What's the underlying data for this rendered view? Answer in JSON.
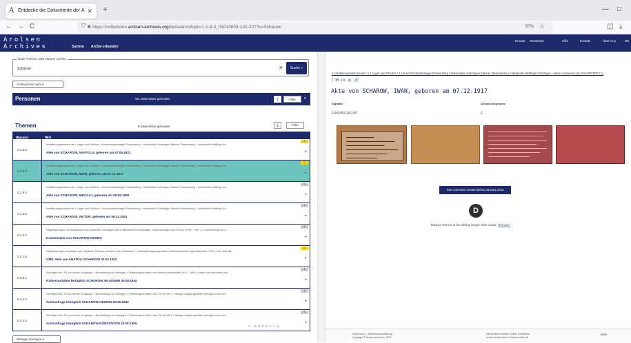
{
  "browser": {
    "tab_title": "Entdecke die Dokumente der A",
    "tab_close": "✕",
    "new_tab": "+",
    "url_prefix": "https://collections.",
    "url_domain": "arolsen-archives.org",
    "url_suffix": "/de/search/topic/1-1-8-3_01010803-102-207?s=Scharow",
    "zoom": "67%",
    "back_icon": "←",
    "forward_icon": "→",
    "reload_icon": "C",
    "minimize": "—",
    "maximize": "□",
    "pocket_icon": "◫",
    "download_icon": "⤓"
  },
  "site": {
    "logo_line1": "Arolsen",
    "logo_line2": "Archives",
    "nav": [
      "Suchen",
      "Archiv erkunden"
    ],
    "top_nav": [
      "Donate",
      "Newsletter",
      "Hilfe",
      "Kontakt",
      "Über Uns",
      "DE"
    ],
    "brand_color": "#1c2a6b"
  },
  "search": {
    "label": "Nach Themen oder Namen suchen",
    "value": "Scharow",
    "clear_icon": "×",
    "button": "Suche",
    "tree_button": "Archival tree units"
  },
  "personen": {
    "title": "Personen",
    "count": "781 Datensätze gefunden",
    "filter": "Filter"
  },
  "themen": {
    "title": "Themen",
    "count": "9 Datensätze gefunden",
    "filter": "Filter",
    "col_signatur": "Signatur",
    "col_titel": "Titel",
    "rows": [
      {
        "sig": "1.1.8.3",
        "bc": "Inhaftierungsdokumente > Lager und Ghettos > Konzentrationslager Flossenbürg > Individuelle Unterlagen Männer Flossenbürg > Individuelle Häftlings Un...",
        "title": "Akte von SCHAROW, ANATOLIJ, geboren am 27.09.1921",
        "count": "1"
      },
      {
        "sig": "1.1.8.3",
        "bc": "Inhaftierungsdokumente > Lager und Ghettos > Konzentrationslager Flossenbürg > Individuelle Unterlagen Männer Flossenbürg > Individuelle Häftlings Un...",
        "title": "Akte von SCHAROW, IWAN, geboren am 07.12.1917",
        "count": "2"
      },
      {
        "sig": "1.1.8.3",
        "bc": "Inhaftierungsdokumente > Lager und Ghettos > Konzentrationslager Flossenbürg > Individuelle Unterlagen Männer Flossenbürg > Individuelle Häftlings Un...",
        "title": "Akte von SCHAROW, NIKOLAJ, geboren am 09.08.1908",
        "count": "1"
      },
      {
        "sig": "1.1.8.3",
        "bc": "Inhaftierungsdokumente > Lager und Ghettos > Konzentrationslager Flossenbürg > Individuelle Unterlagen Männer Flossenbürg > Individuelle Häftlings Un...",
        "title": "Akte von SCHAROW, VIKTOR, geboren am 08.11.1924",
        "count": "1"
      },
      {
        "sig": "2.1.3.2",
        "bc": "Registrierungen von Ausländern und deutschen Verfolgten durch öffentliche Einrichtungen, Versicherungen und Firmen (1939 - 1947) > Durchführung der A...",
        "title": "Krankenakte von SCHAROW GEORG",
        "count": "1"
      },
      {
        "sig": "3.2.1.6",
        "bc": "Registrierungen und Akten von Displaced Persons, Kindern und Vermissten > Unterstützungsprogramme unterschiedlicher Organisationen > IRO „Care and Ma...",
        "title": "CM/1 Akte von ANATOLI SCHAROW 03.03.1922",
        "count": "2"
      },
      {
        "sig": "6.3.3.1",
        "bc": "Schriftgut des ITS und seiner Vorgänger > Bearbeitung von Anfragen > Fallbezogene Akten des Kindersuchdienstes 1947 - 1951 > Akten von namentlich ide...",
        "title": "Kindersuchakte bezüglich SCHAROW WLADIMIR 29.08.1944",
        "count": "1"
      },
      {
        "sig": "6.3.3.3",
        "bc": "Schriftgut des ITS und seiner Vorgänger > Bearbeitung von Anfragen > Fallbezogene Akten des ITS ab 1947 > Ablage negativ geprüfter Anfragen unter ein...",
        "title": "Suchanfrage bezüglich SCHAROW GEORGI 00.00.1930",
        "count": "1"
      },
      {
        "sig": "6.3.3.3",
        "bc": "Schriftgut des ITS und seiner Vorgänger > Bearbeitung von Anfragen > Fallbezogene Akten des ITS ab 1947 > Ablage negativ geprüfter Anfragen unter ein...",
        "title": "Suchanfrage bezüglich SCHAROW KONSTANTIN 22.08.1925",
        "count": "1"
      }
    ],
    "pager": "1 - 9 of 9    |<   <   >   >|",
    "more": "Weniger anzeigen"
  },
  "detail": {
    "breadcrumb": "1 Inhaftierungsdokumente / 1.1 Lager und Ghettos / 1.1.8 Konzentrationslager Flossenbürg / Individuelle Unterlagen Männer Flossenbürg / Individuelle Häftlings Unterlagen / Akten mit Namen ab SCHARDTER / ◫",
    "share_icons": "f  ✉  in  ◎  🔗",
    "title": "Akte von SCHAROW, IWAN, geboren am 07.12.1917",
    "signatur_label": "Signatur",
    "signatur_value": "01010803 102.207",
    "anzahl_label": "Anzahl Dokumente",
    "anzahl_value": "2",
    "comments_button": "See comments created before January 2023",
    "disqus_logo": "D",
    "disqus_text": "Disqus seems to be taking longer than usual.",
    "disqus_reload": "Reload?",
    "footer_left": "Impressum  |  Datenschutzerklärung\nCopyright © Arolsen Archives, 2021",
    "footer_right": "Die Arolsen Archives Online-Collections\nwurden entwickelt in Partnerschaft mit",
    "footer_logo": "DATA"
  }
}
